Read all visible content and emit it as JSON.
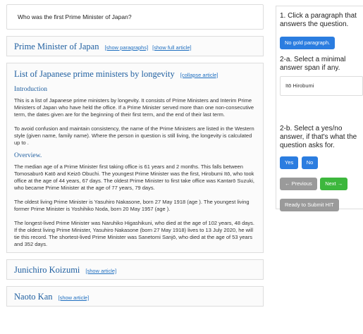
{
  "question": "Who was the first Prime Minister of Japan?",
  "articles": [
    {
      "title": "Prime Minister of Japan",
      "links": [
        "[show paragraphs]",
        "[show full article]"
      ]
    },
    {
      "title": "List of Japanese prime ministers by longevity",
      "link": "[collapse article]",
      "sections": [
        {
          "title": "Introduction",
          "paragraphs": [
            "This is a list of Japanese prime ministers by longevity. It consists of Prime Ministers and Interim Prime Ministers of Japan who have held the office. If a Prime Minister served more than one non-consecutive term, the dates given are for the beginning of their first term, and the end of their last term.",
            "To avoid confusion and maintain consistency, the name of the Prime Ministers are listed in the Western style (given name, family name). Where the person in question is still living, the longevity is calculated up to ."
          ]
        },
        {
          "title": "Overview.",
          "paragraphs": [
            "The median age of a Prime Minister first taking office is 61 years and 2 months. This falls between Tomosaburō Katō and Keizō Obuchi. The youngest Prime Minister was the first, Hirobumi Itō, who took office at the age of 44 years, 67 days. The oldest Prime Minister to first take office was Kantarō Suzuki, who became Prime Minister at the age of 77 years, 79 days.",
            "The oldest living Prime Minister is Yasuhiro Nakasone, born 27 May 1918 (age ). The youngest living former Prime Minister is Yoshihiko Noda, born 20 May 1957 (age ).",
            "The longest-lived Prime Minister was Naruhiko Higashikuni, who died at the age of 102 years, 48 days. If the oldest living Prime Minister, Yasuhiro Nakasone (born 27 May 1918) lives to 13 July 2020, he will tie this record. The shortest-lived Prime Minister was Sanetomi Sanjō, who died at the age of 53 years and 352 days."
          ]
        }
      ]
    },
    {
      "title": "Junichiro Koizumi",
      "link": "[show article]"
    },
    {
      "title": "Naoto Kan",
      "link": "[show article]"
    }
  ],
  "panel": {
    "step1": "1. Click a paragraph that answers the question.",
    "no_gold": "No gold paragraph.",
    "step2a": "2-a. Select a minimal answer span if any.",
    "answer_span": "Itō Hirobumi",
    "step2b": "2-b. Select a yes/no answer, if that's what the question asks for.",
    "yes": "Yes",
    "no": "No",
    "previous": "← Previous",
    "next": "Next →",
    "submit": "Ready to Submit HIT"
  }
}
